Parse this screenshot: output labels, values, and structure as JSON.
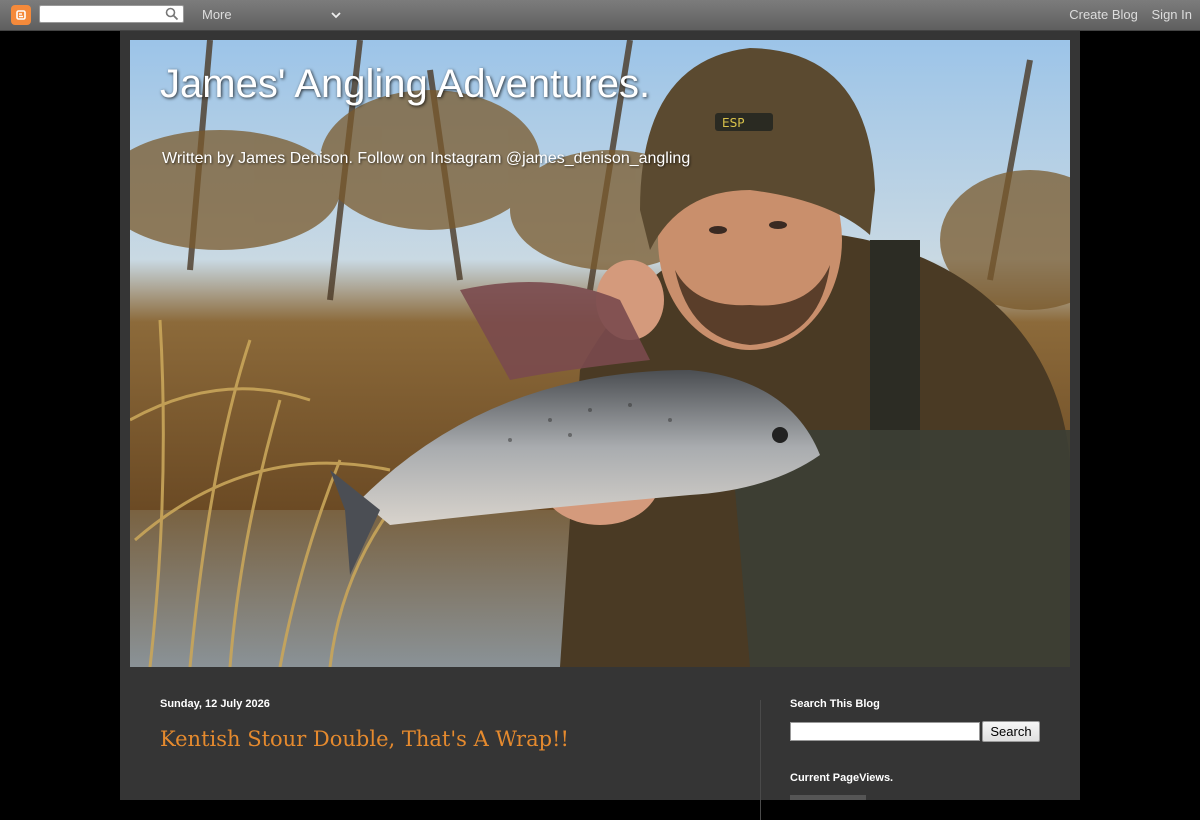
{
  "navbar": {
    "more_label": "More",
    "search_value": "",
    "create_blog_label": "Create Blog",
    "sign_in_label": "Sign In",
    "logo_icon": "blogger-logo-icon",
    "logo_color": "#f58a3b"
  },
  "header": {
    "title": "James' Angling Adventures.",
    "description": "Written by James Denison. Follow on Instagram @james_denison_angling"
  },
  "post": {
    "date": "Sunday, 12 July 2026",
    "title": "Kentish Stour Double, That's A Wrap!!",
    "title_color": "#e58a2e"
  },
  "sidebar": {
    "search_widget_title": "Search This Blog",
    "search_placeholder": "",
    "search_button_label": "Search",
    "pageviews_title": "Current PageViews."
  },
  "colors": {
    "page_background": "#000000",
    "content_background": "#353535",
    "navbar_background": "#6e6e6e"
  }
}
